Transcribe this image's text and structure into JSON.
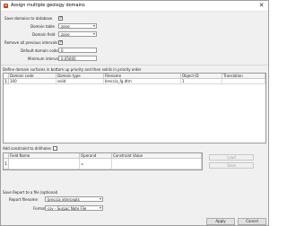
{
  "window": {
    "title": "Assign multiple geology domains",
    "close_glyph": "✕"
  },
  "options": {
    "save_domains_label": "Save domains to database",
    "save_domains_checked": true,
    "domain_table_label": "Domain table",
    "domain_table_value": "zone",
    "domain_field_label": "Domain field",
    "domain_field_value": "zone",
    "remove_intervals_label": "Remove all previous intervals",
    "remove_intervals_checked": true,
    "default_code_label": "Default domain code",
    "default_code_value": "0",
    "min_interval_label": "Minimum interval",
    "min_interval_value": "0.05000"
  },
  "surfaces": {
    "section_label": "Define domain surfaces in bottom up priority and then solids in priority order",
    "columns": [
      "Domain code",
      "Domain type",
      "Filename",
      "Object ID",
      "Translation"
    ],
    "rows": [
      {
        "num": "1",
        "code": "100",
        "type": "solid",
        "filename": "breccia_fg.dtm",
        "object_id": "1",
        "translation": ""
      }
    ]
  },
  "constraint": {
    "add_label": "Add constraint to drillholes",
    "add_checked": false,
    "columns": [
      "Field Name",
      "Operand",
      "Constraint Value"
    ],
    "rows": [
      {
        "num": "1",
        "field": "",
        "operand": "=",
        "value": ""
      }
    ],
    "load_label": "Load",
    "save_label": "Save"
  },
  "report": {
    "save_label": "Save Report to a file (optional)",
    "filename_label": "Report filename",
    "filename_value": "breccia intercepts",
    "format_label": "Format",
    "format_value": "csv - Surpac Note File"
  },
  "footer": {
    "apply_label": "Apply",
    "cancel_label": "Cancel"
  },
  "icons": {
    "check": "✓",
    "dropdown": "chevron-down-icon"
  }
}
